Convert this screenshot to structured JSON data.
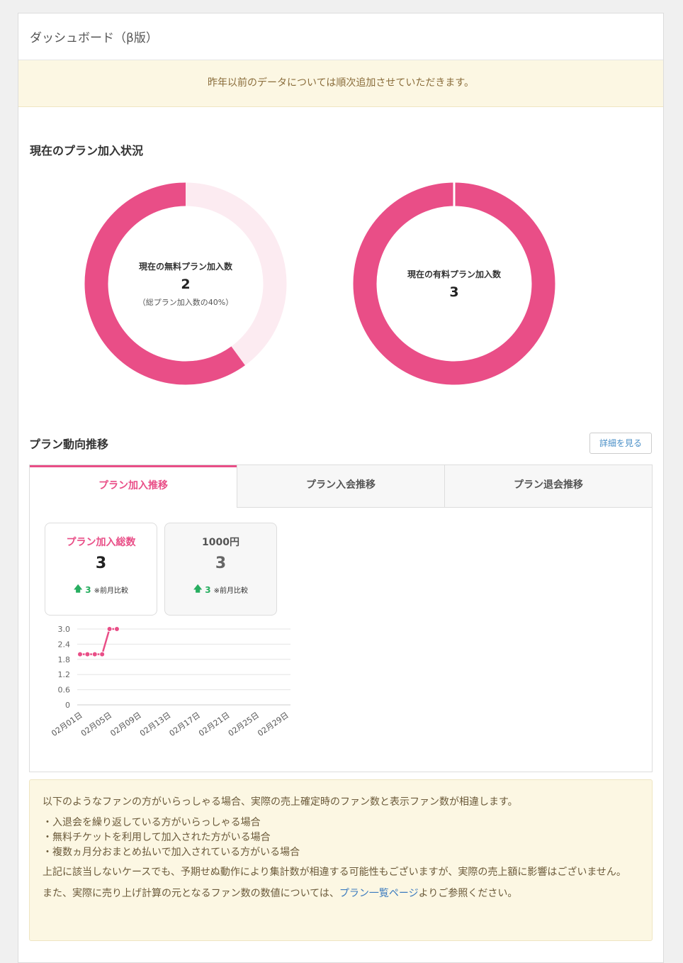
{
  "header": {
    "title": "ダッシュボード（β版）"
  },
  "notice": {
    "text": "昨年以前のデータについては順次追加させていただきます。"
  },
  "plan_status": {
    "title": "現在のプラン加入状況",
    "free": {
      "label": "現在の無料プラン加入数",
      "value": "2",
      "sub": "（総プラン加入数の40%）",
      "ratio": 0.6
    },
    "paid": {
      "label": "現在の有料プラン加入数",
      "value": "3",
      "ratio": 1.0
    },
    "colors": {
      "primary": "#e94e87",
      "track": "#fcebf1"
    }
  },
  "trends": {
    "title": "プラン動向推移",
    "detail_button": "詳細を見る",
    "tabs": [
      {
        "label": "プラン加入推移",
        "active": true
      },
      {
        "label": "プラン入会推移",
        "active": false
      },
      {
        "label": "プラン退会推移",
        "active": false
      }
    ],
    "cards": [
      {
        "title": "プラン加入総数",
        "value": "3",
        "delta": "3",
        "note": "※前月比較"
      },
      {
        "title": "1000円",
        "value": "3",
        "delta": "3",
        "note": "※前月比較"
      }
    ]
  },
  "chart_data": {
    "type": "line",
    "x": [
      "02月01日",
      "02月02日",
      "02月03日",
      "02月04日",
      "02月05日",
      "02月06日"
    ],
    "values": [
      2,
      2,
      2,
      2,
      3,
      3
    ],
    "x_tick_labels": [
      "02月01日",
      "02月05日",
      "02月09日",
      "02月13日",
      "02月17日",
      "02月21日",
      "02月25日",
      "02月29日"
    ],
    "y_ticks": [
      "3.0",
      "2.4",
      "1.8",
      "1.2",
      "0.6",
      "0"
    ],
    "ylim": [
      0,
      3.0
    ],
    "x_range": [
      1,
      29
    ],
    "color": "#e94e87",
    "grid": true
  },
  "info": {
    "intro": "以下のようなファンの方がいらっしゃる場合、実際の売上確定時のファン数と表示ファン数が相違します。",
    "items": [
      "・入退会を繰り返している方がいらっしゃる場合",
      "・無料チケットを利用して加入された方がいる場合",
      "・複数ヵ月分おまとめ払いで加入されている方がいる場合"
    ],
    "para2": "上記に該当しないケースでも、予期せぬ動作により集計数が相違する可能性もございますが、実際の売上額に影響はございません。",
    "para3_prefix": "また、実際に売り上げ計算の元となるファン数の数値については、",
    "para3_link": "プラン一覧ページ",
    "para3_suffix": "よりご参照ください。"
  }
}
